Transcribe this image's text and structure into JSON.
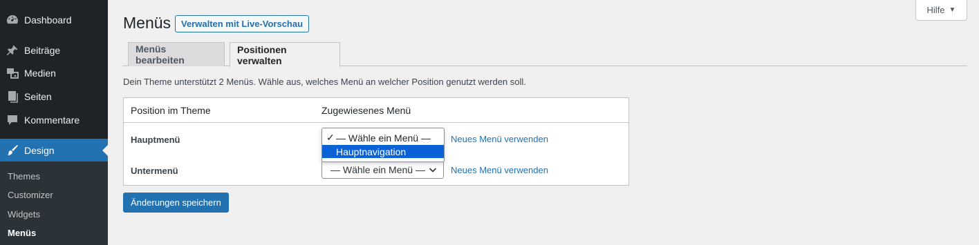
{
  "sidebar": {
    "items": [
      {
        "label": "Dashboard",
        "icon": "dashboard-icon"
      },
      {
        "label": "Beiträge",
        "icon": "pin-icon"
      },
      {
        "label": "Medien",
        "icon": "media-icon"
      },
      {
        "label": "Seiten",
        "icon": "pages-icon"
      },
      {
        "label": "Kommentare",
        "icon": "comment-icon"
      },
      {
        "label": "Design",
        "icon": "brush-icon"
      }
    ],
    "submenu": [
      "Themes",
      "Customizer",
      "Widgets",
      "Menüs"
    ]
  },
  "header": {
    "title": "Menüs",
    "live_preview_label": "Verwalten mit Live-Vorschau",
    "help_label": "Hilfe"
  },
  "tabs": [
    {
      "label": "Menüs bearbeiten"
    },
    {
      "label": "Positionen verwalten"
    }
  ],
  "intro": "Dein Theme unterstützt 2 Menüs. Wähle aus, welches Menü an welcher Position genutzt werden soll.",
  "table": {
    "col_position": "Position im Theme",
    "col_menu": "Zugewiesenes Menü",
    "rows": [
      {
        "label": "Hauptmenü",
        "link": "Neues Menü verwenden"
      },
      {
        "label": "Untermenü",
        "value": "— Wähle ein Menü —",
        "link": "Neues Menü verwenden"
      }
    ]
  },
  "dropdown": {
    "check": "✓",
    "options": [
      "— Wähle ein Menü —",
      "Hauptnavigation"
    ]
  },
  "save_label": "Änderungen speichern",
  "colors": {
    "accent": "#2271b1",
    "sidebar": "#1d2327",
    "submenu": "#2c3338",
    "highlight": "#0b61d6"
  }
}
